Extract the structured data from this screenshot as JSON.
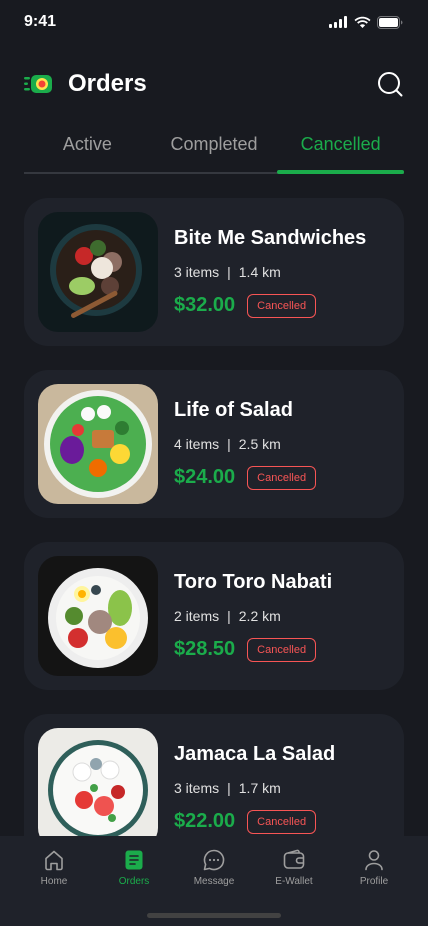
{
  "status_bar": {
    "time": "9:41"
  },
  "header": {
    "title": "Orders",
    "logo_icon": "app-logo-icon",
    "search_icon": "search-icon"
  },
  "tabs": [
    {
      "label": "Active",
      "active": false
    },
    {
      "label": "Completed",
      "active": false
    },
    {
      "label": "Cancelled",
      "active": true
    }
  ],
  "orders": [
    {
      "name": "Bite Me Sandwiches",
      "items": "3 items",
      "distance": "1.4 km",
      "price": "$32.00",
      "status": "Cancelled"
    },
    {
      "name": "Life of Salad",
      "items": "4 items",
      "distance": "2.5 km",
      "price": "$24.00",
      "status": "Cancelled"
    },
    {
      "name": "Toro Toro Nabati",
      "items": "2 items",
      "distance": "2.2 km",
      "price": "$28.50",
      "status": "Cancelled"
    },
    {
      "name": "Jamaca La Salad",
      "items": "3 items",
      "distance": "1.7 km",
      "price": "$22.00",
      "status": "Cancelled"
    }
  ],
  "meta_separator": "|",
  "nav": [
    {
      "label": "Home",
      "icon": "home-icon",
      "active": false
    },
    {
      "label": "Orders",
      "icon": "orders-icon",
      "active": true
    },
    {
      "label": "Message",
      "icon": "message-icon",
      "active": false
    },
    {
      "label": "E-Wallet",
      "icon": "wallet-icon",
      "active": false
    },
    {
      "label": "Profile",
      "icon": "profile-icon",
      "active": false
    }
  ],
  "colors": {
    "accent": "#1bac4b",
    "background": "#181a20",
    "card": "#1f222a",
    "cancelled": "#f75555"
  }
}
